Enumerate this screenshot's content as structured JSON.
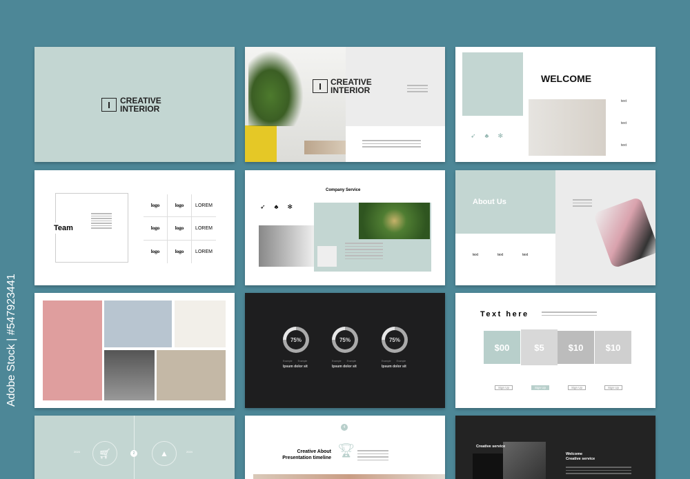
{
  "watermark": "Adobe Stock | #547923441",
  "colors": {
    "background": "#4d8797",
    "sage": "#c3d6d2",
    "dark": "#1e1e1f"
  },
  "slides": {
    "cover": {
      "brand_line1": "CREATIVE",
      "brand_line2": "INTERIOR"
    },
    "cover_photo": {
      "brand_line1": "CREATIVE",
      "brand_line2": "INTERIOR"
    },
    "welcome": {
      "title": "WELCOME",
      "labels": [
        "text",
        "text",
        "text"
      ],
      "icons": [
        "rocket-icon",
        "tree-icon",
        "snowflake-icon"
      ]
    },
    "team": {
      "title": "Team",
      "logos": [
        "logo",
        "logo",
        "LOREM",
        "logo",
        "logo",
        "LOREM",
        "logo",
        "logo",
        "LOREM"
      ]
    },
    "company_service": {
      "title": "Company Service",
      "icons": [
        "rocket-icon",
        "tree-icon",
        "snowflake-icon"
      ]
    },
    "about": {
      "title": "About Us",
      "labels": [
        "text",
        "text",
        "text"
      ]
    },
    "stats": {
      "items": [
        {
          "value": "75%",
          "heading": "Ipsum dolor sit",
          "legend": [
            "Example",
            "Example"
          ]
        },
        {
          "value": "75%",
          "heading": "Ipsum dolor sit",
          "legend": [
            "Example",
            "Example"
          ]
        },
        {
          "value": "75%",
          "heading": "Ipsum dolor sit",
          "legend": [
            "Example",
            "Example"
          ]
        }
      ]
    },
    "pricing": {
      "title": "Text here",
      "plans": [
        {
          "price": "$00",
          "button": "Sign Up"
        },
        {
          "price": "$5",
          "button": "Sign Up"
        },
        {
          "price": "$10",
          "button": "Sign Up"
        },
        {
          "price": "$10",
          "button": "Sign Up"
        }
      ]
    },
    "timeline": {
      "years": [
        "2024",
        "2024"
      ],
      "step": "2"
    },
    "timeline2": {
      "step": "4",
      "title_line1": "Creative About",
      "title_line2": "Presentation timeline"
    },
    "creative_service": {
      "label": "Creative service",
      "title_line1": "Welcome",
      "title_line2": "Creative service"
    }
  }
}
